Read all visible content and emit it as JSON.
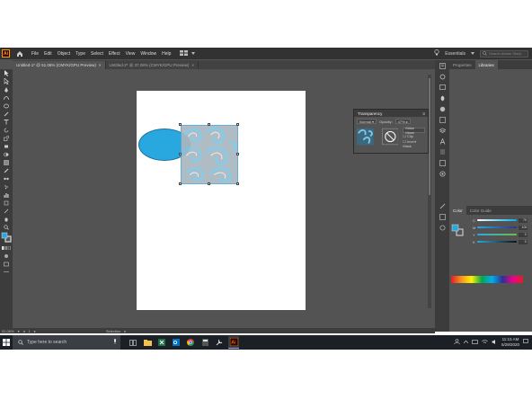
{
  "app": {
    "logo": "Ai"
  },
  "menu": [
    "File",
    "Edit",
    "Object",
    "Type",
    "Select",
    "Effect",
    "View",
    "Window",
    "Help"
  ],
  "workspace": "Essentials",
  "search_placeholder": "Search Adobe Stock",
  "tabs": [
    {
      "label": "Untitled-1* @ 51.06% (CMYK/GPU Preview)",
      "active": true
    },
    {
      "label": "Untitled-2* @ 37.08% (CMYK/GPU Preview)",
      "active": false
    }
  ],
  "panels": {
    "tabs": [
      "Properties",
      "Libraries"
    ],
    "transparency": {
      "title": "Transparency",
      "blend_mode": "Normal",
      "opacity_label": "Opacity:",
      "opacity_value": "47%",
      "make_mask": "Make Mask",
      "clip": "Clip",
      "invert_mask": "Invert Mask"
    },
    "color": {
      "tabs": [
        "Color",
        "Color Guide"
      ],
      "channels": [
        {
          "label": "C",
          "value": "79",
          "color": "#00aeef"
        },
        {
          "label": "M",
          "value": "100",
          "color": "#ec008c"
        },
        {
          "label": "Y",
          "value": "0",
          "color": "#fff200"
        },
        {
          "label": "K",
          "value": "0",
          "color": "#222222"
        }
      ]
    }
  },
  "status": {
    "zoom": "51.06%",
    "page": "1",
    "tool": "Selection"
  },
  "taskbar": {
    "search_placeholder": "Type here to search",
    "time": "11:15 AM",
    "date": "5/29/2020"
  },
  "colors": {
    "ellipse": "#29a8e0",
    "pattern_base": "#a9b7bf",
    "pattern_swirl": "#7fc7e6"
  }
}
